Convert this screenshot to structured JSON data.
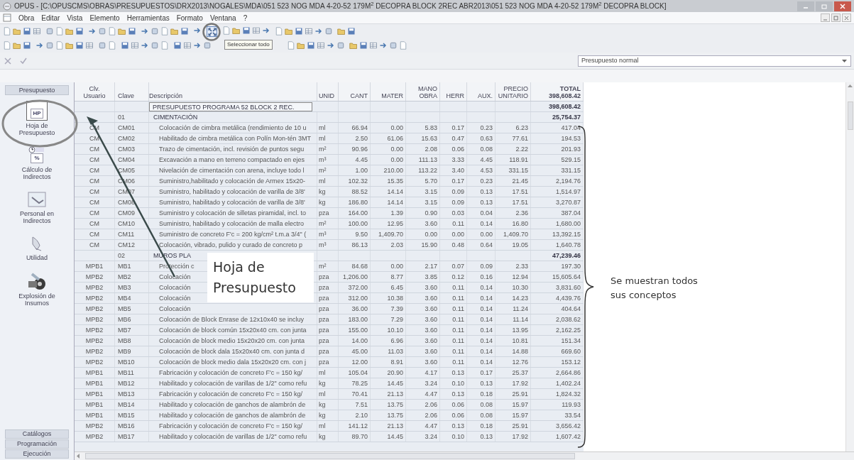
{
  "window": {
    "title": "OPUS - [C:\\OPUSCMS\\OBRAS\\PRESUPUESTOS\\DRX2013\\NOGALES\\MDA\\051 523 NOG MDA 4-20-52 179M$^{2}$ DECOPRA BLOCK 2REC ABR2013\\051 523 NOG MDA 4-20-52 179M$^{2}$ DECOPRA BLOCK]"
  },
  "menu": [
    "Obra",
    "Editar",
    "Vista",
    "Elemento",
    "Herramientas",
    "Formato",
    "Ventana",
    "?"
  ],
  "tooltip": "Seleccionar todo",
  "budget_type": {
    "value": "Presupuesto normal"
  },
  "sidebar": {
    "top_button": "Presupuesto",
    "items": [
      {
        "label": "Hoja de Presupuesto",
        "kind": "sheet",
        "icon_text": "HP"
      },
      {
        "label": "Cálculo de Indirectos",
        "kind": "calc",
        "icon_text": "%"
      },
      {
        "label": "Personal en Indirectos",
        "kind": "staff"
      },
      {
        "label": "Utilidad",
        "kind": "profit"
      },
      {
        "label": "Explosión de Insumos",
        "kind": "explode"
      }
    ],
    "bottom_buttons": [
      "Catálogos",
      "Programación",
      "Ejecución"
    ]
  },
  "table": {
    "columns": [
      "Clv.\nUsuario",
      "Clave",
      "Descripción",
      "UNID",
      "CANT",
      "MATER",
      "MANO\nOBRA",
      "HERR",
      "AUX.",
      "PRECIO\nUNITARIO",
      "TOTAL"
    ],
    "header_total": "398,608.42",
    "rows": [
      {
        "kind": "grand_total",
        "description": "PRESUPUESTO PROGRAMA 52 BLOCK 2 REC.",
        "total": "398,608.42"
      },
      {
        "kind": "section",
        "code": "01",
        "description": "CIMENTACIÓN",
        "total": "25,754.37"
      },
      {
        "kind": "item",
        "cells": [
          "CM",
          "CM01",
          "Colocación de cimbra metálica (rendimiento de 10 u",
          "ml",
          "66.94",
          "0.00",
          "5.83",
          "0.17",
          "0.23",
          "6.23",
          "417.04"
        ]
      },
      {
        "kind": "item",
        "cells": [
          "CM",
          "CM02",
          "Habilitado de cimbra metálica con Polín Mon-tén 3MT",
          "ml",
          "2.50",
          "61.06",
          "15.63",
          "0.47",
          "0.63",
          "77.61",
          "194.53"
        ]
      },
      {
        "kind": "item",
        "cells": [
          "CM",
          "CM03",
          "Trazo  de cimentación, incl. revisión de puntos segu",
          "m²",
          "90.96",
          "0.00",
          "2.08",
          "0.06",
          "0.08",
          "2.22",
          "201.93"
        ]
      },
      {
        "kind": "item",
        "cells": [
          "CM",
          "CM04",
          "Excavación a mano en terreno compactado en ejes",
          "m³",
          "4.45",
          "0.00",
          "111.13",
          "3.33",
          "4.45",
          "118.91",
          "529.15"
        ]
      },
      {
        "kind": "item",
        "cells": [
          "CM",
          "CM05",
          "Nivelación de cimentación con arena, incluye todo l",
          "m²",
          "1.00",
          "210.00",
          "113.22",
          "3.40",
          "4.53",
          "331.15",
          "331.15"
        ]
      },
      {
        "kind": "item",
        "cells": [
          "CM",
          "CM06",
          "Suministro,habilitado y colocación de Armex 15x20-",
          "ml",
          "102.32",
          "15.35",
          "5.70",
          "0.17",
          "0.23",
          "21.45",
          "2,194.76"
        ]
      },
      {
        "kind": "item",
        "cells": [
          "CM",
          "CM07",
          "Suministro, habilitado y colocación de varilla de 3/8'",
          "kg",
          "88.52",
          "14.14",
          "3.15",
          "0.09",
          "0.13",
          "17.51",
          "1,514.97"
        ]
      },
      {
        "kind": "item",
        "cells": [
          "CM",
          "CM08",
          "Suministro, habilitado y colocación de varilla de 3/8'",
          "kg",
          "186.80",
          "14.14",
          "3.15",
          "0.09",
          "0.13",
          "17.51",
          "3,270.87"
        ]
      },
      {
        "kind": "item",
        "cells": [
          "CM",
          "CM09",
          "Suministro y colocación de silletas piramidal, incl. to",
          "pza",
          "164.00",
          "1.39",
          "0.90",
          "0.03",
          "0.04",
          "2.36",
          "387.04"
        ]
      },
      {
        "kind": "item",
        "cells": [
          "CM",
          "CM10",
          "Suministro, habilitado y colocación de malla electro",
          "m²",
          "100.00",
          "12.95",
          "3.60",
          "0.11",
          "0.14",
          "16.80",
          "1,680.00"
        ]
      },
      {
        "kind": "item",
        "cells": [
          "CM",
          "CM11",
          "Suministro de concreto F'c = 200 kg/cm² t.m.a 3/4\" (",
          "m³",
          "9.50",
          "1,409.70",
          "0.00",
          "0.00",
          "0.00",
          "1,409.70",
          "13,392.15"
        ]
      },
      {
        "kind": "item",
        "cells": [
          "CM",
          "CM12",
          "Colocación, vibrado, pulido y curado de concreto p",
          "m³",
          "86.13",
          "2.03",
          "15.90",
          "0.48",
          "0.64",
          "19.05",
          "1,640.78"
        ]
      },
      {
        "kind": "section",
        "code": "02",
        "description": "MUROS PLA",
        "total": "47,239.46"
      },
      {
        "kind": "item",
        "cells": [
          "MPB1",
          "MB1",
          "Protección c",
          "m²",
          "84.68",
          "0.00",
          "2.17",
          "0.07",
          "0.09",
          "2.33",
          "197.30"
        ]
      },
      {
        "kind": "item",
        "cells": [
          "MPB2",
          "MB2",
          "Colocación",
          "pza",
          "1,206.00",
          "8.77",
          "3.85",
          "0.12",
          "0.16",
          "12.94",
          "15,605.64"
        ]
      },
      {
        "kind": "item",
        "cells": [
          "MPB2",
          "MB3",
          "Colocación",
          "pza",
          "372.00",
          "6.45",
          "3.60",
          "0.11",
          "0.14",
          "10.30",
          "3,831.60"
        ]
      },
      {
        "kind": "item",
        "cells": [
          "MPB2",
          "MB4",
          "Colocación",
          "pza",
          "312.00",
          "10.38",
          "3.60",
          "0.11",
          "0.14",
          "14.23",
          "4,439.76"
        ]
      },
      {
        "kind": "item",
        "cells": [
          "MPB2",
          "MB5",
          "Colocación",
          "pza",
          "36.00",
          "7.39",
          "3.60",
          "0.11",
          "0.14",
          "11.24",
          "404.64"
        ]
      },
      {
        "kind": "item",
        "cells": [
          "MPB2",
          "MB6",
          "Colocación de Block Enrase de 12x10x40 se incluy",
          "pza",
          "183.00",
          "7.29",
          "3.60",
          "0.11",
          "0.14",
          "11.14",
          "2,038.62"
        ]
      },
      {
        "kind": "item",
        "cells": [
          "MPB2",
          "MB7",
          "Colocación de block común 15x20x40 cm. con junta",
          "pza",
          "155.00",
          "10.10",
          "3.60",
          "0.11",
          "0.14",
          "13.95",
          "2,162.25"
        ]
      },
      {
        "kind": "item",
        "cells": [
          "MPB2",
          "MB8",
          "Colocación de block medio 15x20x20 cm. con junta",
          "pza",
          "14.00",
          "6.96",
          "3.60",
          "0.11",
          "0.14",
          "10.81",
          "151.34"
        ]
      },
      {
        "kind": "item",
        "cells": [
          "MPB2",
          "MB9",
          "Colocación de block dala 15x20x40 cm. con junta d",
          "pza",
          "45.00",
          "11.03",
          "3.60",
          "0.11",
          "0.14",
          "14.88",
          "669.60"
        ]
      },
      {
        "kind": "item",
        "cells": [
          "MPB2",
          "MB10",
          "Colocación de block medio dala 15x20x20 cm. con j",
          "pza",
          "12.00",
          "8.91",
          "3.60",
          "0.11",
          "0.14",
          "12.76",
          "153.12"
        ]
      },
      {
        "kind": "item",
        "cells": [
          "MPB1",
          "MB11",
          "Fabricación y colocación de concreto F'c = 150 kg/",
          "ml",
          "105.04",
          "20.90",
          "4.17",
          "0.13",
          "0.17",
          "25.37",
          "2,664.86"
        ]
      },
      {
        "kind": "item",
        "cells": [
          "MPB1",
          "MB12",
          "Habilitado y colocación de varillas de 1/2\" como refu",
          "kg",
          "78.25",
          "14.45",
          "3.24",
          "0.10",
          "0.13",
          "17.92",
          "1,402.24"
        ]
      },
      {
        "kind": "item",
        "cells": [
          "MPB1",
          "MB13",
          "Fabricación y colocación de concreto F'c = 150 kg/",
          "ml",
          "70.41",
          "21.13",
          "4.47",
          "0.13",
          "0.18",
          "25.91",
          "1,824.32"
        ]
      },
      {
        "kind": "item",
        "cells": [
          "MPB1",
          "MB14",
          "Habilitado y colocación de ganchos de alambrón de",
          "kg",
          "7.51",
          "13.75",
          "2.06",
          "0.06",
          "0.08",
          "15.97",
          "119.93"
        ]
      },
      {
        "kind": "item",
        "cells": [
          "MPB1",
          "MB15",
          "Habilitado y colocación de ganchos de alambrón de",
          "kg",
          "2.10",
          "13.75",
          "2.06",
          "0.06",
          "0.08",
          "15.97",
          "33.54"
        ]
      },
      {
        "kind": "item",
        "cells": [
          "MPB2",
          "MB16",
          "Fabricación y colocación de concreto F'c = 150 kg/",
          "ml",
          "141.12",
          "21.13",
          "4.47",
          "0.13",
          "0.18",
          "25.91",
          "3,656.42"
        ]
      },
      {
        "kind": "item",
        "cells": [
          "MPB2",
          "MB17",
          "Habilitado y colocación de varillas de 1/2\" como refu",
          "kg",
          "89.70",
          "14.45",
          "3.24",
          "0.10",
          "0.13",
          "17.92",
          "1,607.42"
        ]
      }
    ]
  },
  "annotations": {
    "callout": "Hoja de Presupuesto",
    "note": "Se muestran todos sus conceptos"
  }
}
